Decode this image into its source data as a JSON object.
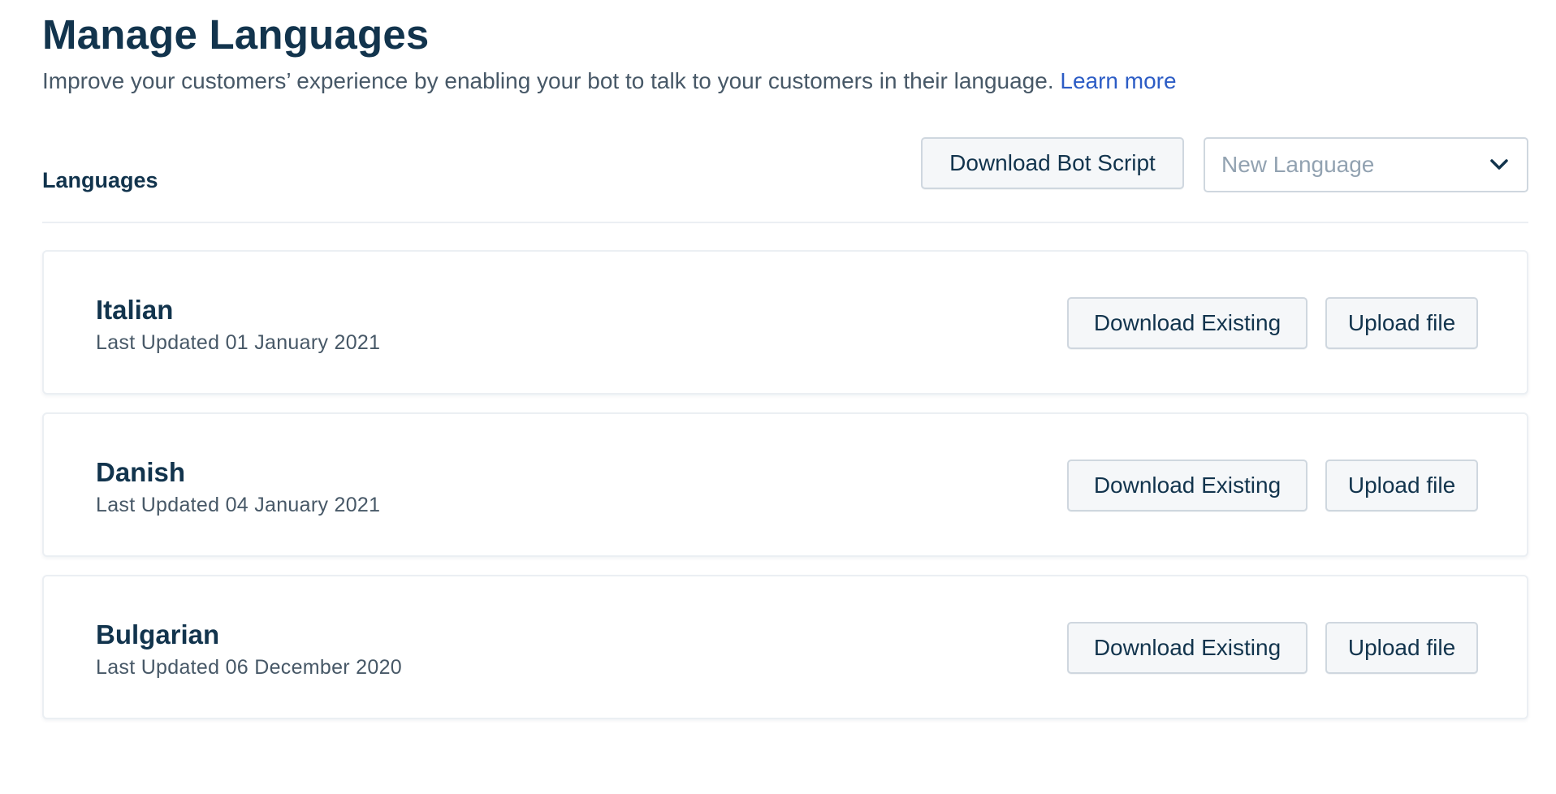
{
  "header": {
    "title": "Manage Languages",
    "description": "Improve your customers’ experience by enabling your bot to talk to your customers in their language.",
    "learn_more": "Learn more"
  },
  "toolbar": {
    "section_label": "Languages",
    "download_bot_script": "Download Bot Script",
    "new_language_placeholder": "New Language",
    "new_language_icon": "chevron-down-icon"
  },
  "languages": [
    {
      "name": "Italian",
      "updated": "Last Updated 01 January 2021",
      "download_label": "Download Existing",
      "upload_label": "Upload file"
    },
    {
      "name": "Danish",
      "updated": "Last Updated 04 January 2021",
      "download_label": "Download Existing",
      "upload_label": "Upload file"
    },
    {
      "name": "Bulgarian",
      "updated": "Last Updated 06 December 2020",
      "download_label": "Download Existing",
      "upload_label": "Upload file"
    }
  ],
  "colors": {
    "text_primary": "#12344d",
    "text_secondary": "#475867",
    "link": "#2c5cc5",
    "border": "#cfd7df",
    "button_bg": "#f5f7f9",
    "placeholder": "#92a2b1"
  }
}
